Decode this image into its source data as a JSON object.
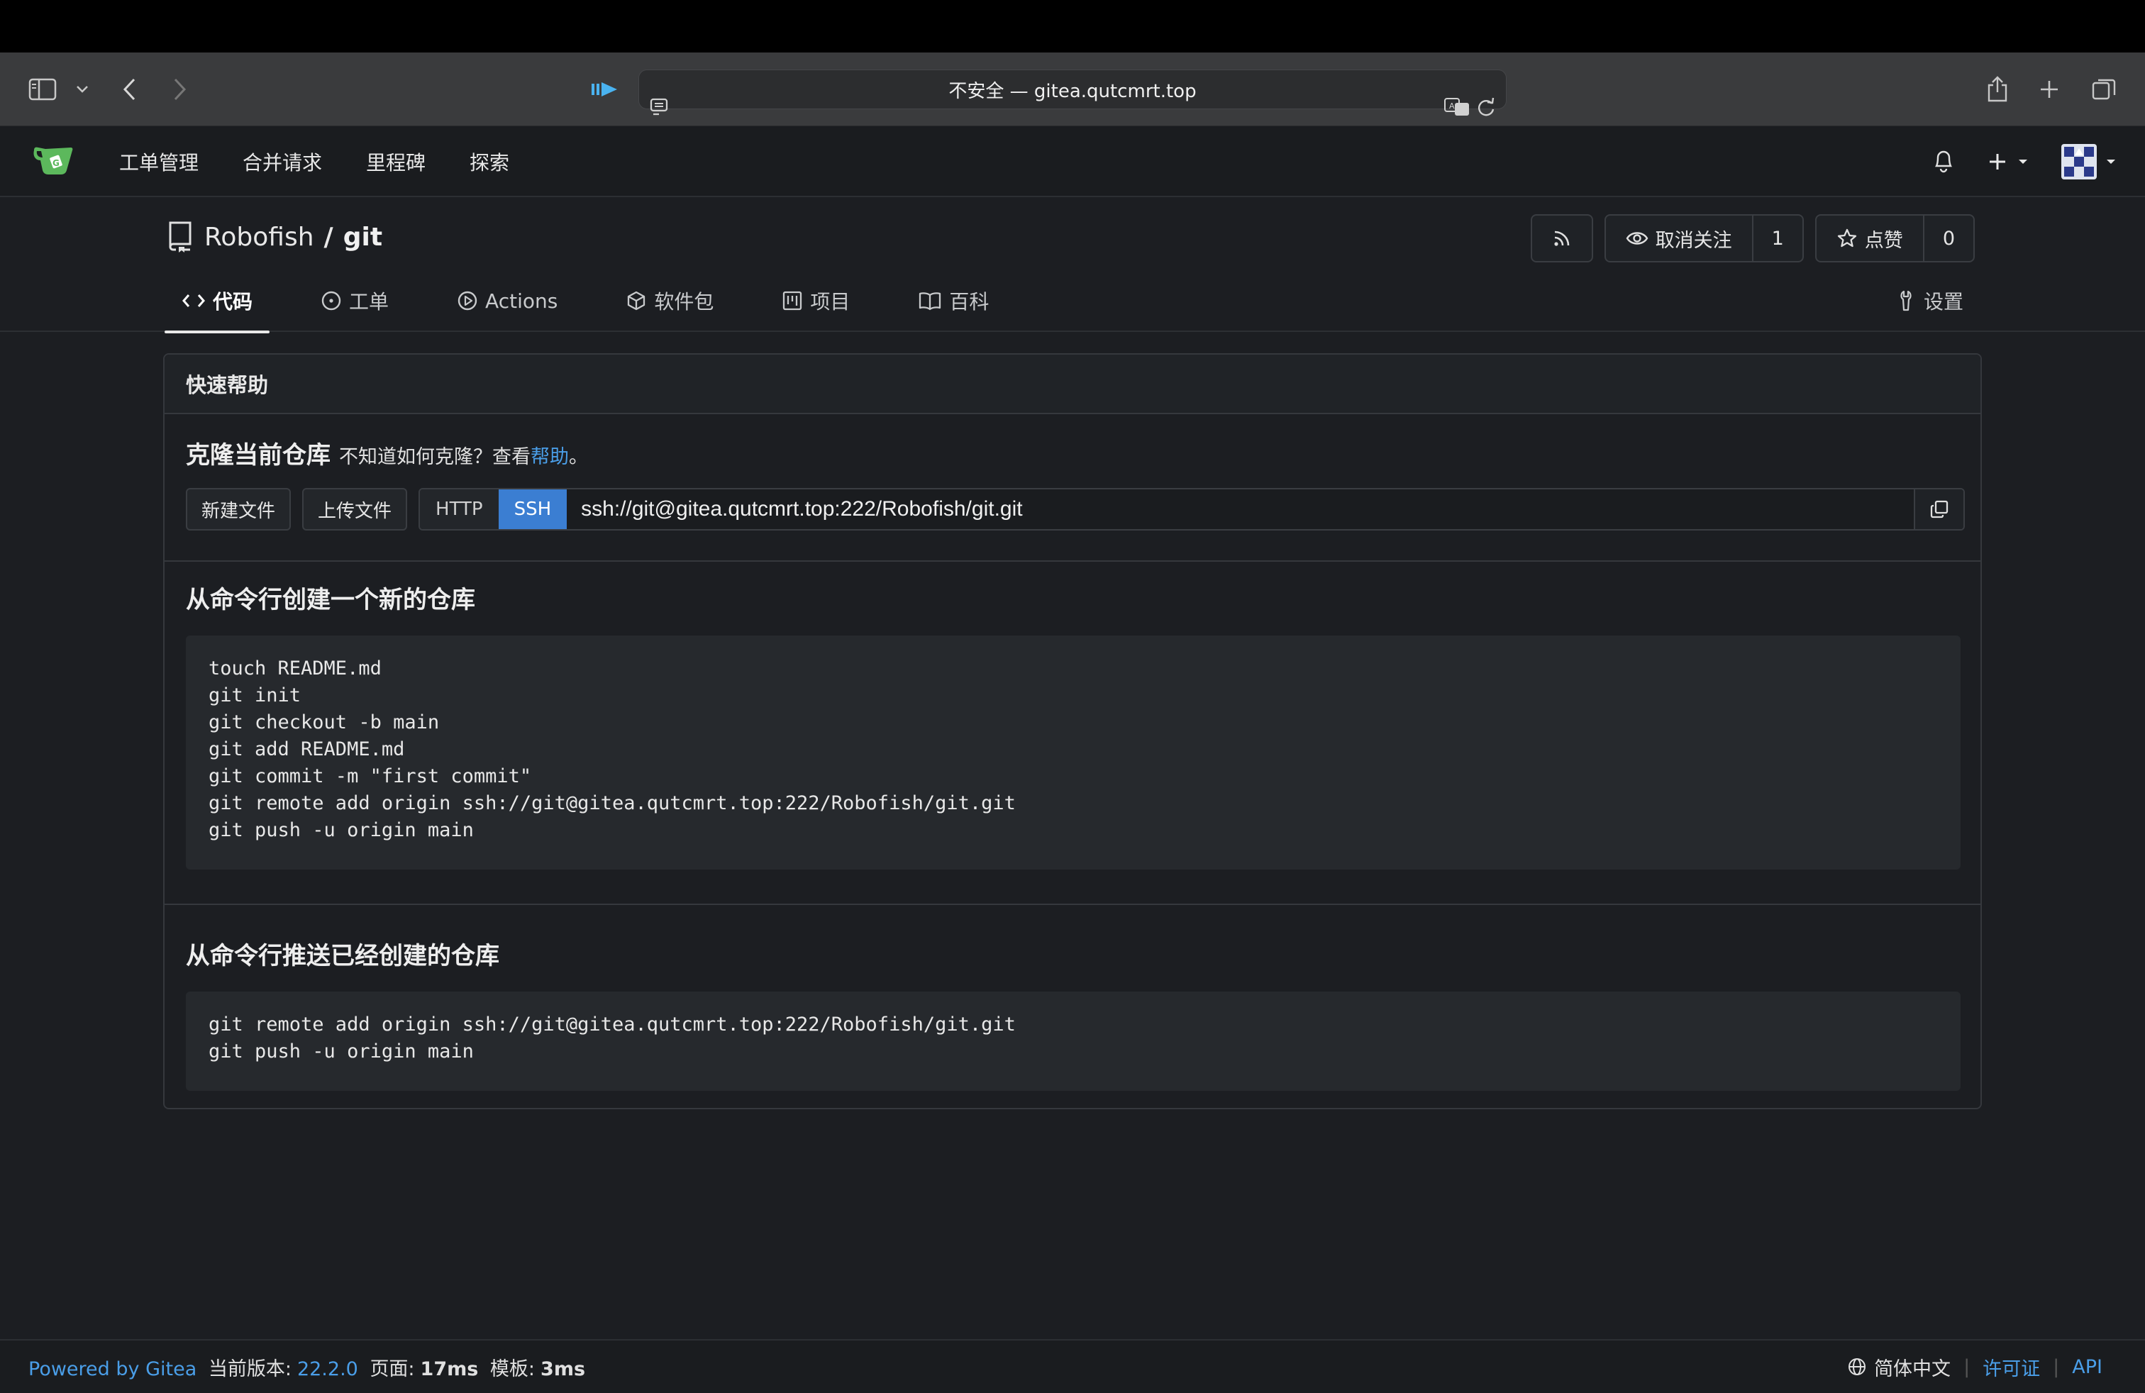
{
  "browser": {
    "address": "不安全 — gitea.qutcmrt.top"
  },
  "nav": {
    "items": [
      "工单管理",
      "合并请求",
      "里程碑",
      "探索"
    ]
  },
  "repo": {
    "owner": "Robofish",
    "slash": "/",
    "name": "git",
    "unwatch_label": "取消关注",
    "watch_count": "1",
    "star_label": "点赞",
    "star_count": "0",
    "tabs": [
      {
        "label": "代码",
        "icon": "code-icon"
      },
      {
        "label": "工单",
        "icon": "issue-icon"
      },
      {
        "label": "Actions",
        "icon": "play-icon"
      },
      {
        "label": "软件包",
        "icon": "package-icon"
      },
      {
        "label": "项目",
        "icon": "project-icon"
      },
      {
        "label": "百科",
        "icon": "book-icon"
      }
    ],
    "settings_label": "设置"
  },
  "quick_help": {
    "title": "快速帮助",
    "clone_title": "克隆当前仓库",
    "clone_hint_pre": "不知道如何克隆？查看",
    "clone_hint_link": "帮助",
    "clone_hint_post": "。",
    "new_file": "新建文件",
    "upload_file": "上传文件",
    "http": "HTTP",
    "ssh": "SSH",
    "clone_url": "ssh://git@gitea.qutcmrt.top:222/Robofish/git.git",
    "create_title": "从命令行创建一个新的仓库",
    "create_code": "touch README.md\ngit init\ngit checkout -b main\ngit add README.md\ngit commit -m \"first commit\"\ngit remote add origin ssh://git@gitea.qutcmrt.top:222/Robofish/git.git\ngit push -u origin main",
    "push_title": "从命令行推送已经创建的仓库",
    "push_code": "git remote add origin ssh://git@gitea.qutcmrt.top:222/Robofish/git.git\ngit push -u origin main"
  },
  "footer": {
    "powered": "Powered by Gitea",
    "version_label": "当前版本:",
    "version": "22.2.0",
    "page_label": "页面:",
    "page_time": "17ms",
    "template_label": "模板:",
    "template_time": "3ms",
    "language": "简体中文",
    "license": "许可证",
    "api": "API"
  },
  "colors": {
    "accent": "#3b7ed2",
    "link": "#4a9ee8",
    "logo": "#5cb85c"
  }
}
